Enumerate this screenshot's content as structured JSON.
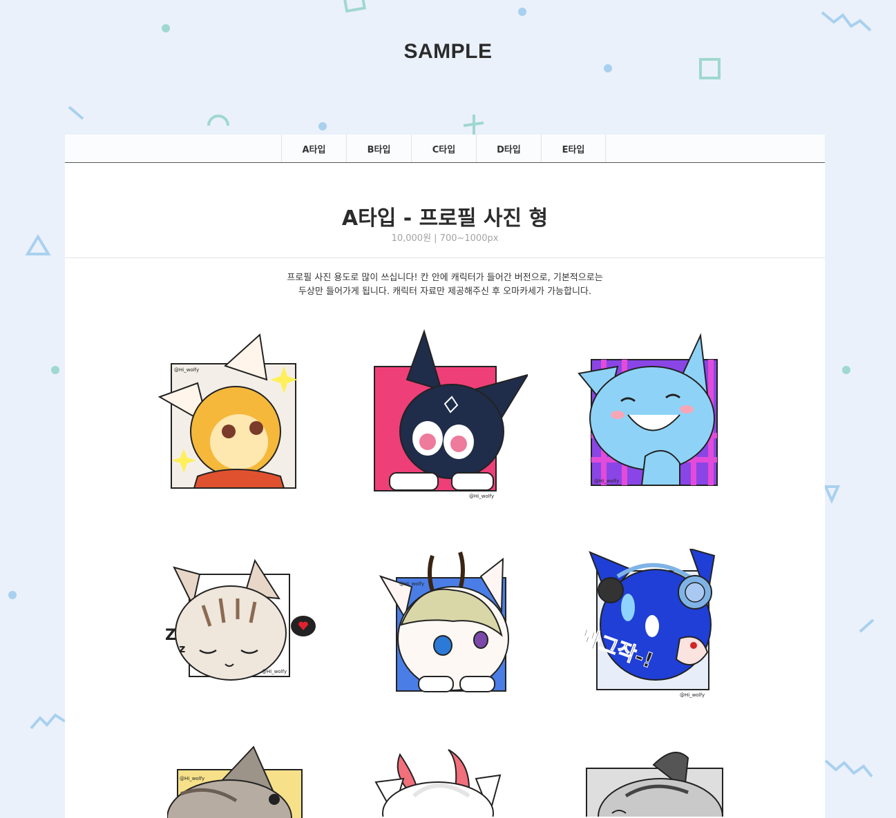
{
  "page": {
    "title": "SAMPLE"
  },
  "tabs": [
    {
      "label": "A타입"
    },
    {
      "label": "B타입"
    },
    {
      "label": "C타입"
    },
    {
      "label": "D타입"
    },
    {
      "label": "E타입"
    }
  ],
  "section": {
    "title": "A타입 - 프로필 사진 형",
    "subtitle": "10,000원 | 700~1000px",
    "description_lines": [
      "프로필 사진 용도로 많이 쓰십니다! 칸 안에 캐릭터가 들어간 버전으로, 기본적으로는",
      "두상만 들어가게 됩니다. 캐릭터 자료만 제공해주신 후 오마카세가 가능합니다."
    ]
  },
  "gallery": {
    "credit": "@Hi_wolfy",
    "sfx_text": "뫄그작-!",
    "items": [
      {
        "icon": "yellow-fox-illustration"
      },
      {
        "icon": "navy-cat-illustration"
      },
      {
        "icon": "blue-wolf-illustration"
      },
      {
        "icon": "tabby-cat-illustration"
      },
      {
        "icon": "antlered-cat-illustration"
      },
      {
        "icon": "blue-headphone-cat-illustration"
      },
      {
        "icon": "gray-cat-illustration"
      },
      {
        "icon": "horned-white-cat-illustration"
      },
      {
        "icon": "grayscale-dog-illustration"
      }
    ]
  },
  "colors": {
    "background": "#eaf1fb",
    "panel": "#ffffff",
    "decoration": "#9fd8cf",
    "decoration_blue": "#a9d0ef",
    "title": "#2b2b2b"
  }
}
